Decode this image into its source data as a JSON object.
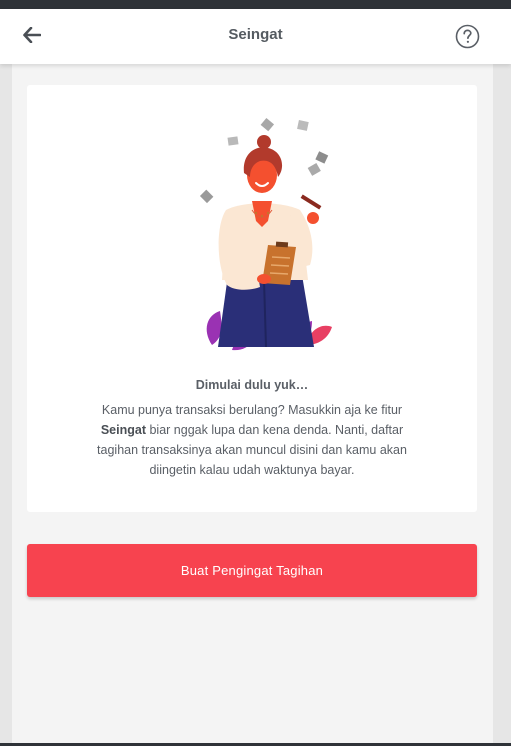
{
  "header": {
    "title": "Seingat"
  },
  "empty_state": {
    "heading": "Dimulai dulu yuk…",
    "desc_part1": "Kamu punya transaksi berulang? Masukkin aja ke fitur ",
    "desc_bold": "Seingat",
    "desc_part2": " biar nggak lupa dan kena denda. Nanti, daftar tagihan transaksinya akan muncul disini dan kamu akan diingetin kalau udah waktunya bayar."
  },
  "cta": {
    "label": "Buat Pengingat Tagihan"
  },
  "colors": {
    "primary": "#f7434f",
    "text": "#5a5f66",
    "skin": "#f4502f",
    "hair": "#b23a2c",
    "sweater": "#fbe7d3",
    "skirt": "#2a2f78",
    "clipboard": "#c8722d",
    "leaves": "#9a32b3"
  }
}
